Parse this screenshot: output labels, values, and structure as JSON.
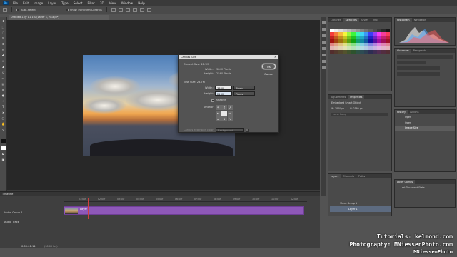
{
  "menubar": {
    "logo": "Ps",
    "items": [
      "File",
      "Edit",
      "Image",
      "Layer",
      "Type",
      "Select",
      "Filter",
      "3D",
      "View",
      "Window",
      "Help"
    ]
  },
  "options": {
    "auto_select": "Auto-Select:",
    "show_transform": "Show Transform Controls"
  },
  "document": {
    "tab_title": "Untitled-1 @ 11.1% (Layer 1, RGB/8*)",
    "status": "3840 px x 2560 px (72 ppi)"
  },
  "dialog": {
    "title": "Canvas Size",
    "current_size_label": "Current Size: 28.1M",
    "width_label": "Width:",
    "width_value": "3840 Pixels",
    "height_label": "Height:",
    "height_value": "2560 Pixels",
    "new_size_label": "New Size: 23.7M",
    "new_width": "3840",
    "new_height": "2160",
    "unit": "Pixels",
    "relative_label": "Relative",
    "anchor_label": "Anchor:",
    "extension_label": "Canvas extension color:",
    "extension_value": "Background",
    "ok": "OK",
    "cancel": "Cancel"
  },
  "right_panels": {
    "swatch_tabs": [
      "Libraries",
      "Swatches",
      "Styles",
      "Info"
    ],
    "swatch_active": "Swatches",
    "histogram_tabs": [
      "Histogram",
      "Navigator"
    ],
    "character_tabs": [
      "Character",
      "Paragraph"
    ],
    "properties_tabs": [
      "Adjustments",
      "Properties"
    ],
    "properties_title": "Embedded Smart Object",
    "properties_w": "W: 3840 px",
    "properties_h": "H: 2560 px",
    "layer_comp": "Layer Comp",
    "history_tabs": [
      "History",
      "Actions"
    ],
    "history_items": [
      "Open",
      "Open",
      "Image Size"
    ],
    "layers_tabs": [
      "Layers",
      "Channels",
      "Paths"
    ],
    "layers": [
      "Video Group 1",
      "Layer 1"
    ],
    "layer_comps_tab": "Layer Comps",
    "last_document_state": "Last Document State"
  },
  "timeline": {
    "title": "Timeline",
    "track_video": "Video Group 1",
    "track_audio": "Audio Track",
    "clip_label": "Layer 1",
    "timecode": "0:00:01:11",
    "fps": "(30.00 fps)",
    "ruler": [
      "01:00f",
      "02:00f",
      "03:00f",
      "04:00f",
      "05:00f",
      "06:00f",
      "07:00f",
      "08:00f",
      "09:00f",
      "10:00f",
      "11:00f",
      "12:00f"
    ]
  },
  "watermarks": {
    "line1": "Tutorials: kelmond.com",
    "line2": "Photography: MNiessenPhoto.com",
    "line3": "MNiessenPhoto"
  },
  "colors": {
    "clip": "#8e58b8",
    "accent": "#31a8ff"
  }
}
